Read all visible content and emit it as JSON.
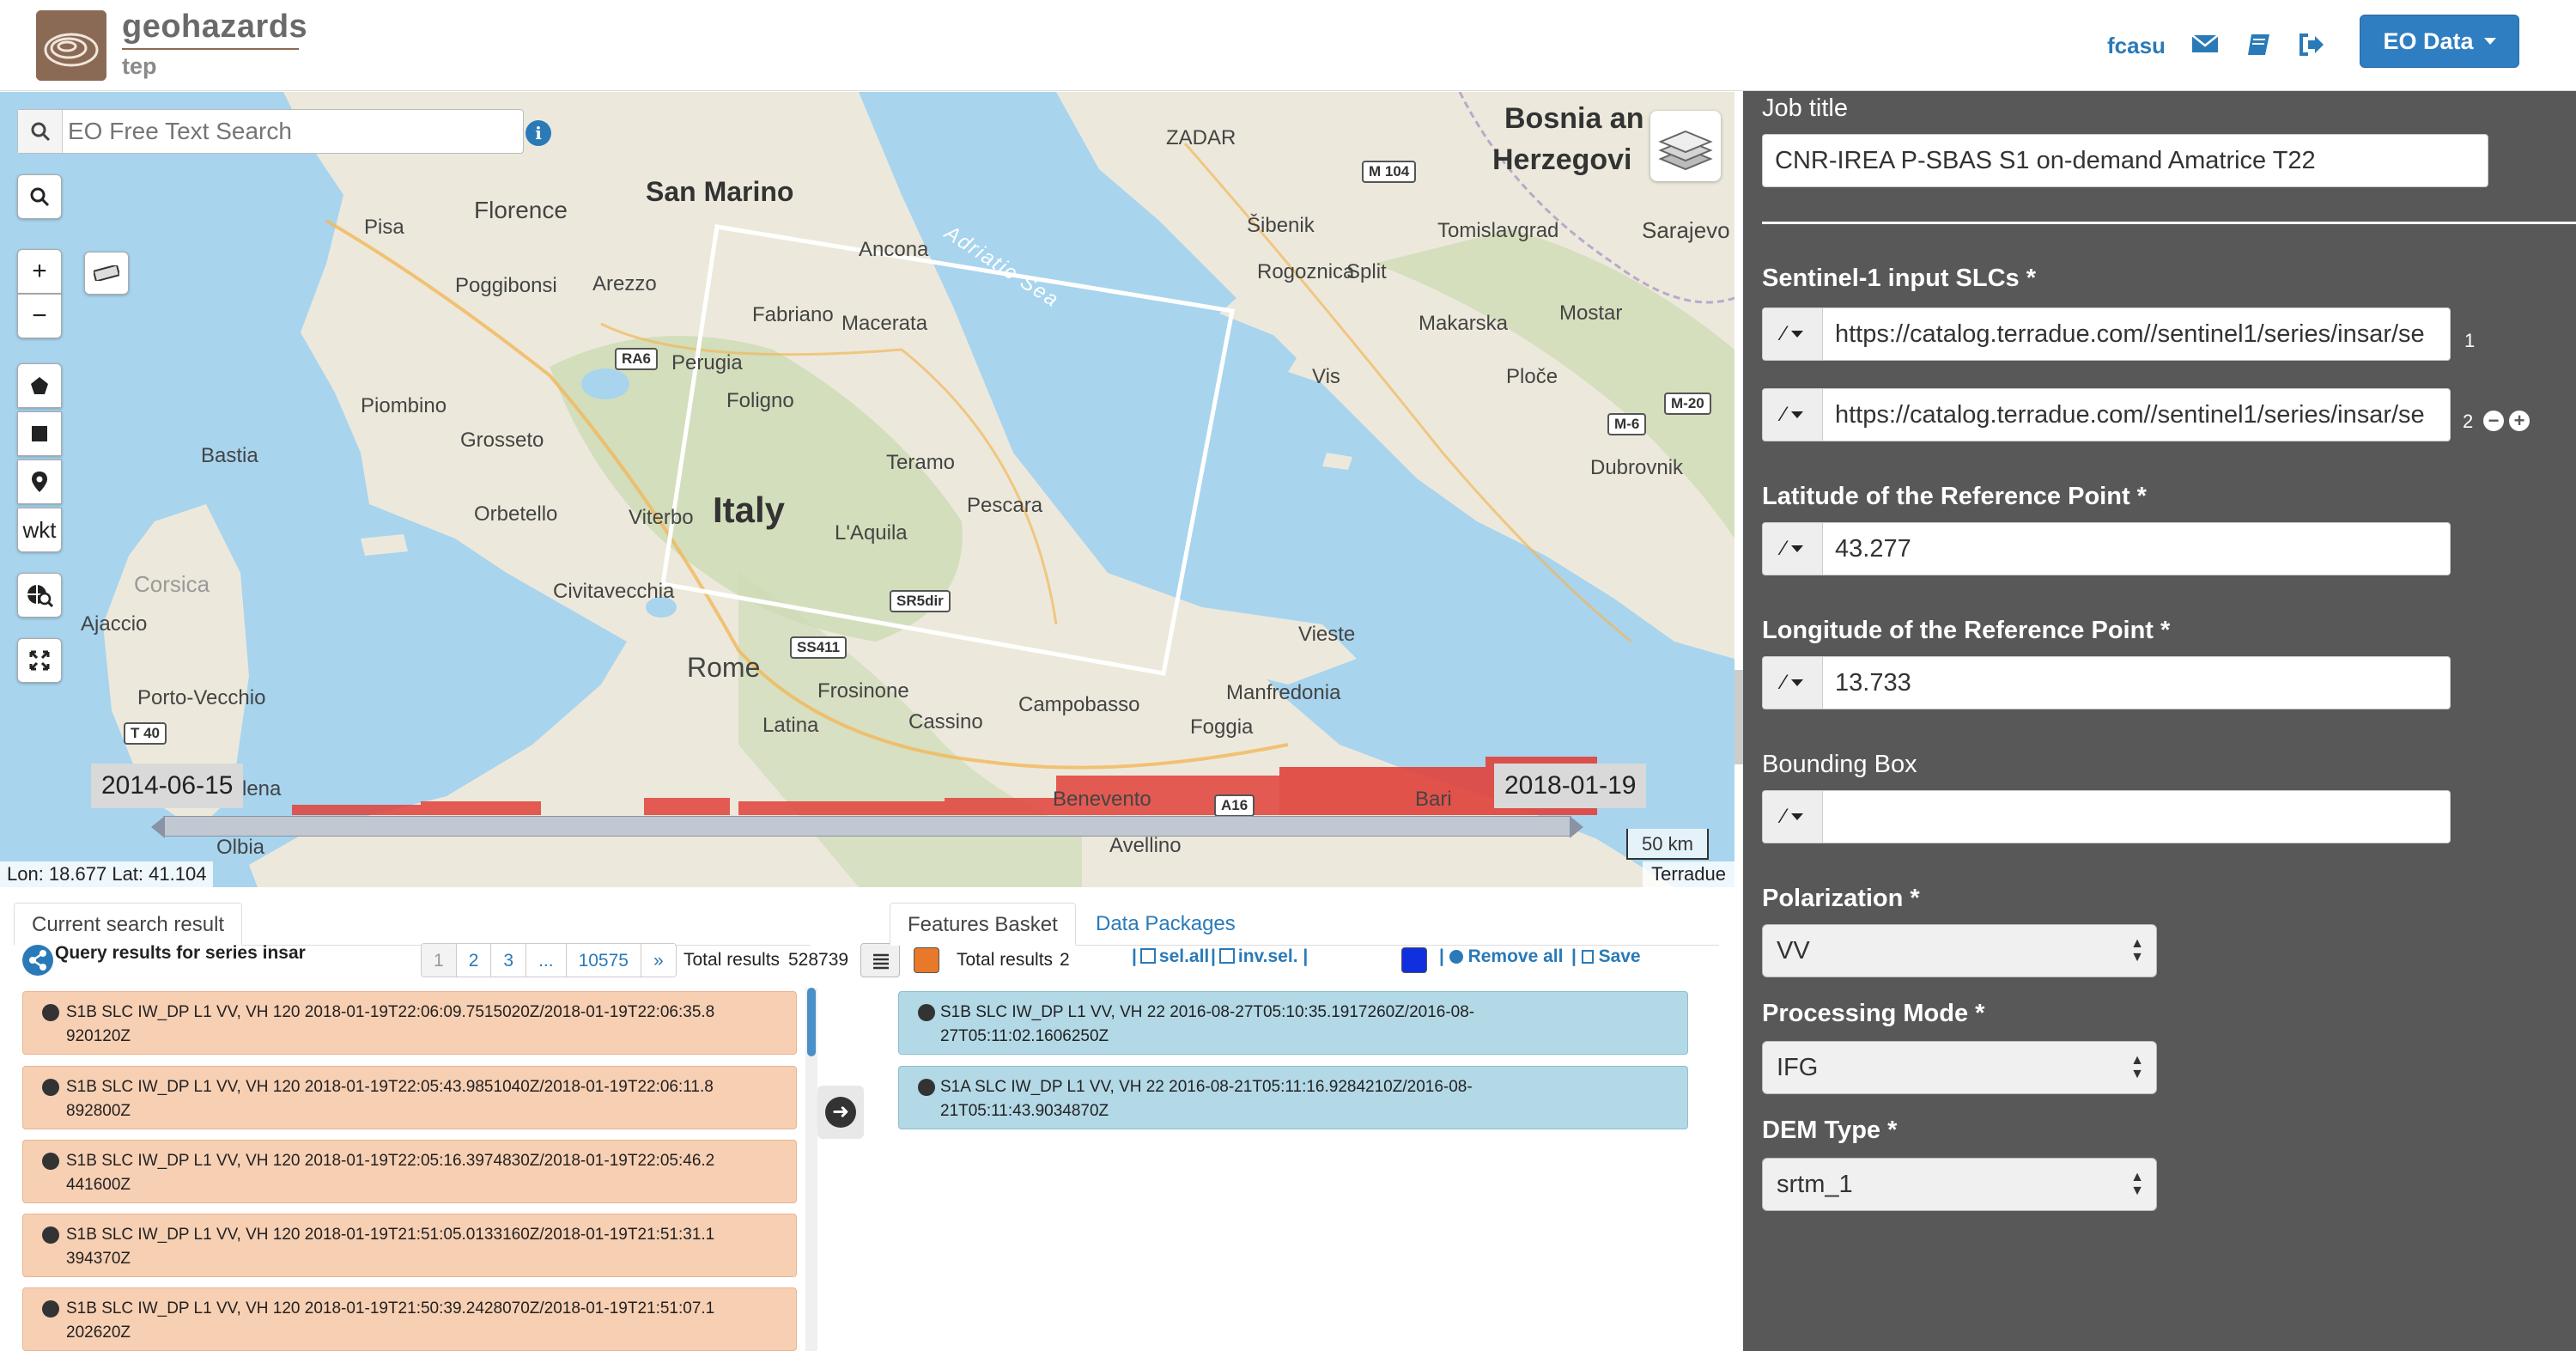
{
  "header": {
    "brand_title": "geohazards",
    "brand_sub": "tep",
    "user": "fcasu",
    "eo_button": "EO Data",
    "icons": [
      "mail-icon",
      "book-icon",
      "logout-icon"
    ]
  },
  "map": {
    "search_placeholder": "EO Free Text Search",
    "draw_tools": [
      "zoom-in",
      "zoom-out",
      "polygon",
      "rectangle",
      "marker",
      "wkt"
    ],
    "wkt_label": "wkt",
    "labels": {
      "italy": "Italy",
      "bosnia": "Bosnia an",
      "herzegovina": "Herzegovi",
      "san_marino": "San Marino",
      "florence": "Florence",
      "pisa": "Pisa",
      "poggibonsi": "Poggibonsi",
      "arezzo": "Arezzo",
      "perugia": "Perugia",
      "fabriano": "Fabriano",
      "macerata": "Macerata",
      "ancona": "Ancona",
      "foligno": "Foligno",
      "piombino": "Piombino",
      "grosseto": "Grosseto",
      "teramo": "Teramo",
      "pescara": "Pescara",
      "laquila": "L'Aquila",
      "orbetello": "Orbetello",
      "viterbo": "Viterbo",
      "civitavecchia": "Civitavecchia",
      "rome": "Rome",
      "frosinone": "Frosinone",
      "latina": "Latina",
      "cassino": "Cassino",
      "campobasso": "Campobasso",
      "foggia": "Foggia",
      "manfredonia": "Manfredonia",
      "vieste": "Vieste",
      "benevento": "Benevento",
      "bari": "Bari",
      "avellino": "Avellino",
      "bastia": "Bastia",
      "corsica": "Corsica",
      "ajaccio": "Ajaccio",
      "porto_vecchio": "Porto-Vecchio",
      "olbia": "Olbia",
      "zadar": "ZADAR",
      "sibenik": "Šibenik",
      "split": "Split",
      "tomislavgrad": "Tomislavgrad",
      "sarajevo": "Sarajevo",
      "rogoznica": "Rogoznica",
      "makarska": "Makarska",
      "mostar": "Mostar",
      "vis": "Vis",
      "ploce": "Ploče",
      "dubrovnik": "Dubrovnik",
      "adriatic": "Adriatic Sea",
      "lena": "lena"
    },
    "roads": {
      "m104": "M 104",
      "ra6": "RA6",
      "m20": "M-20",
      "m6": "M-6",
      "sr5dir": "SR5dir",
      "ss411": "SS411",
      "t40": "T 40",
      "a16": "A16"
    },
    "timeline": {
      "start": "2014-06-15",
      "end": "2018-01-19"
    },
    "scale": "50 km",
    "coords": "Lon: 18.677  Lat: 41.104",
    "attribution": "Terradue"
  },
  "results": {
    "tab_label": "Current search result",
    "heading": "Query results for series insar",
    "pages": [
      "1",
      "2",
      "3",
      "...",
      "10575",
      "»"
    ],
    "total_label": "Total results",
    "total_value": "528739",
    "items": [
      {
        "l1": "S1B SLC IW_DP L1 VV, VH 120 2018-01-19T22:06:09.7515020Z/2018-01-19T22:06:35.8",
        "l2": "920120Z"
      },
      {
        "l1": "S1B SLC IW_DP L1 VV, VH 120 2018-01-19T22:05:43.9851040Z/2018-01-19T22:06:11.8",
        "l2": "892800Z"
      },
      {
        "l1": "S1B SLC IW_DP L1 VV, VH 120 2018-01-19T22:05:16.3974830Z/2018-01-19T22:05:46.2",
        "l2": "441600Z"
      },
      {
        "l1": "S1B SLC IW_DP L1 VV, VH 120 2018-01-19T21:51:05.0133160Z/2018-01-19T21:51:31.1",
        "l2": "394370Z"
      },
      {
        "l1": "S1B SLC IW_DP L1 VV, VH 120 2018-01-19T21:50:39.2428070Z/2018-01-19T21:51:07.1",
        "l2": "202620Z"
      }
    ]
  },
  "basket": {
    "tab_label": "Features Basket",
    "tab2_label": "Data Packages",
    "total_label": "Total results",
    "total_value": "2",
    "sel_all": "sel.all",
    "inv_sel": "inv.sel.",
    "remove_all": "Remove all",
    "save": "Save",
    "swatch_orange": "#e8782a",
    "swatch_blue": "#1030e0",
    "items": [
      {
        "l1": "S1B SLC IW_DP L1 VV, VH 22 2016-08-27T05:10:35.1917260Z/2016-08-",
        "l2": "27T05:11:02.1606250Z"
      },
      {
        "l1": "S1A SLC IW_DP L1 VV, VH 22 2016-08-21T05:11:16.9284210Z/2016-08-",
        "l2": "21T05:11:43.9034870Z"
      }
    ]
  },
  "form": {
    "job_title_label": "Job title",
    "job_title_value": "CNR-IREA P-SBAS S1 on-demand Amatrice T22",
    "slc_label": "Sentinel-1 input SLCs *",
    "slc_values": [
      "https://catalog.terradue.com//sentinel1/series/insar/se",
      "https://catalog.terradue.com//sentinel1/series/insar/se"
    ],
    "slc_indices": [
      "1",
      "2"
    ],
    "lat_label": "Latitude of the Reference Point *",
    "lat_value": "43.277",
    "lon_label": "Longitude of the Reference Point *",
    "lon_value": "13.733",
    "bbox_label": "Bounding Box",
    "bbox_value": "",
    "polarization_label": "Polarization *",
    "polarization_value": "VV",
    "processing_label": "Processing Mode *",
    "processing_value": "IFG",
    "dem_label": "DEM Type *",
    "dem_value": "srtm_1"
  },
  "colors": {
    "accent": "#2f7ec2",
    "panel": "#585858",
    "result_bg": "#f7cfb3",
    "basket_bg": "#b3d8e6",
    "histogram": "#e0413a"
  }
}
